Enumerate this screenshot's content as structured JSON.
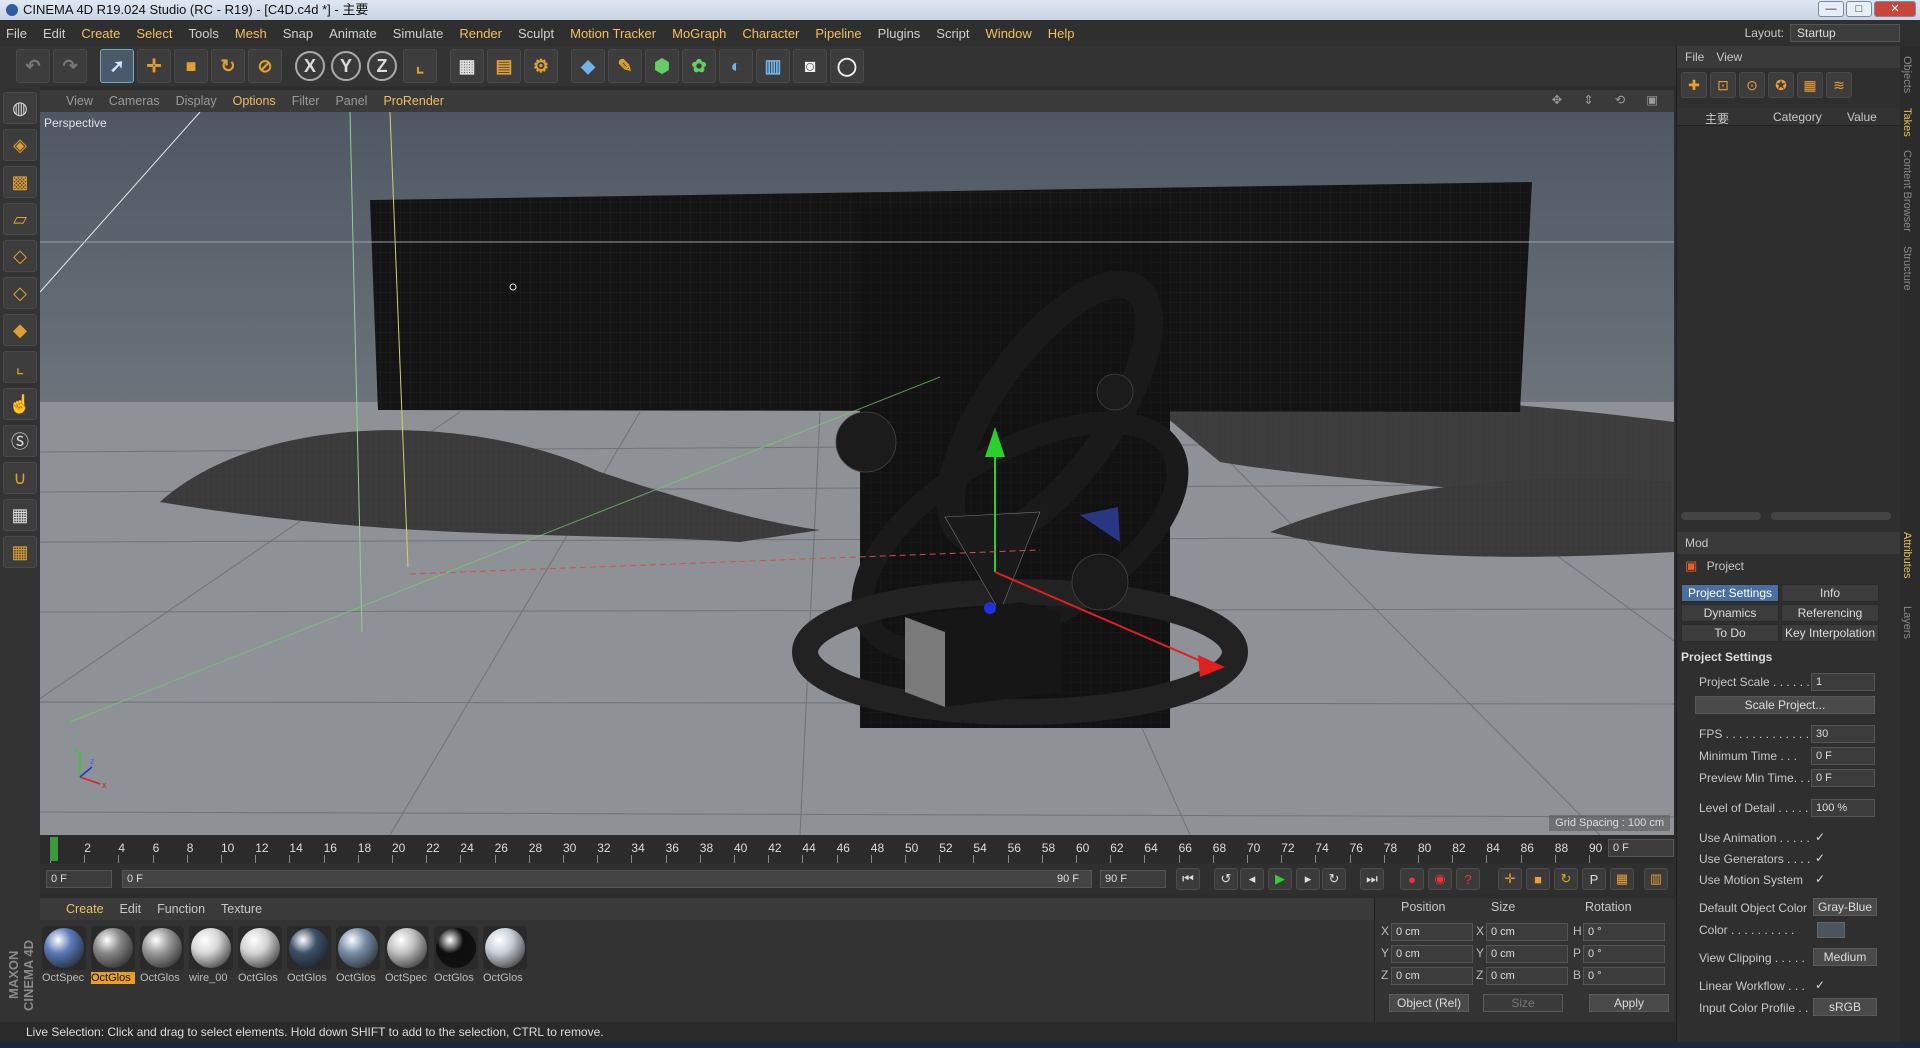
{
  "window": {
    "title": "CINEMA 4D R19.024 Studio (RC - R19) - [C4D.c4d *] - 主要",
    "min": "—",
    "max": "□",
    "close": "✕"
  },
  "menu": [
    "File",
    "Edit",
    "Create",
    "Select",
    "Tools",
    "Mesh",
    "Snap",
    "Animate",
    "Simulate",
    "Render",
    "Sculpt",
    "Motion Tracker",
    "MoGraph",
    "Character",
    "Pipeline",
    "Plugins",
    "Script",
    "Window",
    "Help"
  ],
  "layout": {
    "label": "Layout:",
    "value": "Startup"
  },
  "toolbar_icons": [
    "undo-icon",
    "redo-icon",
    "live-selection-icon",
    "move-icon",
    "scale-icon",
    "rotate-icon",
    "recent-tool-icon",
    "x-axis-icon",
    "y-axis-icon",
    "z-axis-icon",
    "coordinate-system-icon",
    "render-view-icon",
    "render-picture-viewer-icon",
    "edit-render-settings-icon",
    "cube-icon",
    "pen-icon",
    "subdivision-icon",
    "array-icon",
    "deformer-icon",
    "floor-icon",
    "camera-icon",
    "light-icon"
  ],
  "axis_labels": {
    "x": "X",
    "y": "Y",
    "z": "Z"
  },
  "viewport": {
    "menu": [
      "View",
      "Cameras",
      "Display",
      "Options",
      "Filter",
      "Panel",
      "ProRender"
    ],
    "label": "Perspective",
    "grid_spacing": "Grid Spacing : 100 cm",
    "sky_color": "#5b6470",
    "floor_color": "#8d9094",
    "axis_gizmo": {
      "x": "x",
      "y": "y",
      "z": "z"
    }
  },
  "timeline": {
    "ticks": [
      "0",
      "2",
      "4",
      "6",
      "8",
      "10",
      "12",
      "14",
      "16",
      "18",
      "20",
      "22",
      "24",
      "26",
      "28",
      "30",
      "32",
      "34",
      "36",
      "38",
      "40",
      "42",
      "44",
      "46",
      "48",
      "50",
      "52",
      "54",
      "56",
      "58",
      "60",
      "62",
      "64",
      "66",
      "68",
      "70",
      "72",
      "74",
      "76",
      "78",
      "80",
      "82",
      "84",
      "86",
      "88",
      "90"
    ],
    "current_frame": "0 F"
  },
  "transport": {
    "start_field": "0 F",
    "range_start": "0 F",
    "range_end": "90 F",
    "end_field": "90 F"
  },
  "materials": {
    "menu": [
      "Create",
      "Edit",
      "Function",
      "Texture"
    ],
    "items": [
      {
        "name": "OctSpec",
        "color": "#5a7ab8"
      },
      {
        "name": "OctGlos",
        "color": "#888888"
      },
      {
        "name": "OctGlos",
        "color": "#9a9a9a"
      },
      {
        "name": "wire_00",
        "color": "#d8d8d8"
      },
      {
        "name": "OctGlos",
        "color": "#d4d4d4"
      },
      {
        "name": "OctGlos",
        "color": "#3c5068"
      },
      {
        "name": "OctGlos",
        "color": "#7890a8"
      },
      {
        "name": "OctSpec",
        "color": "#c0c0c0"
      },
      {
        "name": "OctGlos",
        "color": "#0e0e0e"
      },
      {
        "name": "OctGlos",
        "color": "#c8d0d8"
      }
    ],
    "selected_index": 1
  },
  "coordinates": {
    "headers": [
      "Position",
      "Size",
      "Rotation"
    ],
    "rows": [
      {
        "a": "X",
        "pos": "0 cm",
        "b": "X",
        "size": "0 cm",
        "c": "H",
        "rot": "0 °"
      },
      {
        "a": "Y",
        "pos": "0 cm",
        "b": "Y",
        "size": "0 cm",
        "c": "P",
        "rot": "0 °"
      },
      {
        "a": "Z",
        "pos": "0 cm",
        "b": "Z",
        "size": "0 cm",
        "c": "B",
        "rot": "0 °"
      }
    ],
    "mode": "Object (Rel)",
    "size_mode": "Size",
    "apply": "Apply"
  },
  "status": "Live Selection: Click and drag to select elements. Hold down SHIFT to add to the selection, CTRL to remove.",
  "objects": {
    "menu": [
      "File",
      "View"
    ],
    "columns": [
      "主要",
      "Category",
      "Value"
    ]
  },
  "attributes": {
    "menu": "Mod",
    "object": "Project",
    "tabs": [
      "Project Settings",
      "Info",
      "Dynamics",
      "Referencing",
      "To Do",
      "Key Interpolation"
    ],
    "section": "Project Settings",
    "project_scale": {
      "label": "Project Scale . . . . . .",
      "value": "1"
    },
    "scale_project": "Scale Project...",
    "fps": {
      "label": "FPS . . . . . . . . . . . . . .",
      "value": "30"
    },
    "min_time": {
      "label": "Minimum Time . . .",
      "value": "0 F"
    },
    "preview_min": {
      "label": "Preview Min Time. . .",
      "value": "0 F"
    },
    "lod": {
      "label": "Level of Detail . . . . .",
      "value": "100 %"
    },
    "use_animation": "Use Animation . . . . .",
    "use_generators": "Use Generators . . . .",
    "use_motion": "Use Motion System",
    "check": "✓",
    "default_color": {
      "label": "Default Object Color",
      "value": "Gray-Blue"
    },
    "color": {
      "label": "Color . . . . . . . . . .",
      "swatch": "#4a5560"
    },
    "view_clipping": {
      "label": "View Clipping . . . . .",
      "value": "Medium"
    },
    "linear_workflow": "Linear Workflow . . .",
    "input_profile": {
      "label": "Input Color Profile . .",
      "value": "sRGB"
    }
  },
  "side_tabs": [
    "Objects",
    "Takes",
    "Content Browser",
    "Structure",
    "Attributes",
    "Layers"
  ]
}
